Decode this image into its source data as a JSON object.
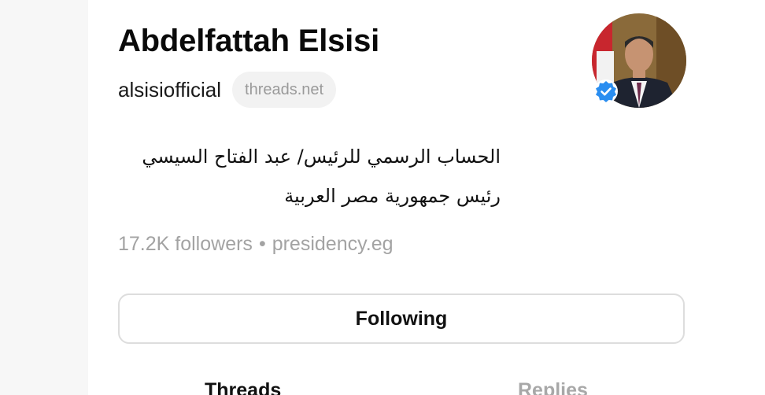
{
  "profile": {
    "name": "Abdelfattah Elsisi",
    "handle": "alsisiofficial",
    "domain_badge": "threads.net",
    "bio_lines": [
      "الحساب الرسمي للرئيس/ عبد الفتاح السيسي",
      "رئيس جمهورية مصر العربية"
    ],
    "followers": "17.2K followers",
    "separator": "•",
    "link": "presidency.eg",
    "verified": true
  },
  "actions": {
    "follow_label": "Following"
  },
  "tabs": [
    {
      "label": "Threads",
      "active": true
    },
    {
      "label": "Replies",
      "active": false
    }
  ],
  "icons": {
    "verified": "verified-check-icon"
  },
  "colors": {
    "verified_blue": "#2b8ef0",
    "muted_text": "#a3a3a3",
    "button_border": "#dddddd"
  }
}
